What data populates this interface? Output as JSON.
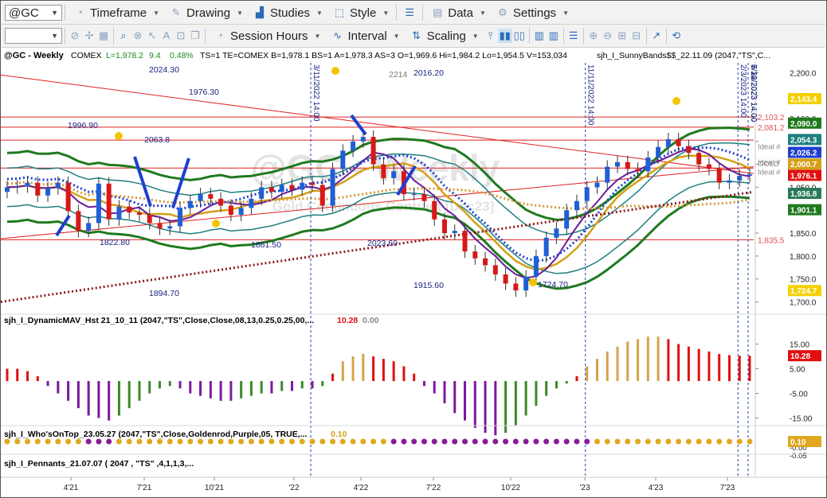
{
  "toolbar1": {
    "symbol_value": "@GC",
    "timeframe": "Timeframe",
    "drawing": "Drawing",
    "studies": "Studies",
    "style": "Style",
    "data": "Data",
    "settings": "Settings"
  },
  "toolbar2": {
    "session_hours": "Session Hours",
    "interval": "Interval",
    "scaling": "Scaling"
  },
  "chart_data": {
    "type": "candlestick",
    "header": {
      "symbol": "@GC - Weekly",
      "exchange": "COMEX",
      "last": "L=1,978.2",
      "change": "9.4",
      "pct": "0.48%",
      "rest": "TS=1  TE=COMEX  B=1,978.1  BS=1  A=1,978.3  AS=3  O=1,969.6  Hi=1,984.2  Lo=1,954.5  V=153,034",
      "study": "sjh_I_SunnyBands$$_22.11.09 (2047,\"TS\",C..."
    },
    "watermark": "@GC - Weekly",
    "watermark2": "Gold Continuous Contract [Dec23]",
    "x_ticks": [
      "4'21",
      "7'21",
      "10'21",
      "'22",
      "4'22",
      "7'22",
      "10'22",
      "'23",
      "4'23",
      "7'23"
    ],
    "y_ticks": [
      "2,200.0",
      "2,150.0",
      "2,100.0",
      "2,050.0",
      "2,000.0",
      "1,950.0",
      "1,900.0",
      "1,850.0",
      "1,800.0",
      "1,750.0",
      "1,700.0"
    ],
    "ylim": [
      1680,
      2225
    ],
    "close": [
      1950,
      1952,
      1960,
      1932,
      1948,
      1960,
      1898,
      1855,
      1872,
      1958,
      1880,
      1908,
      1895,
      1890,
      1872,
      1860,
      1865,
      1905,
      1920,
      1935,
      1925,
      1910,
      1890,
      1905,
      1925,
      1950,
      1940,
      1955,
      1945,
      1960,
      1955,
      1910,
      1990,
      2030,
      2050,
      2060,
      2000,
      1970,
      1985,
      1935,
      1935,
      1920,
      1880,
      1850,
      1855,
      1810,
      1795,
      1780,
      1760,
      1740,
      1725,
      1755,
      1800,
      1840,
      1860,
      1900,
      1920,
      1950,
      1960,
      1995,
      2005,
      1990,
      1985,
      2015,
      2038,
      2055,
      2040,
      2025,
      2000,
      1990,
      1960,
      1965,
      1975,
      1978
    ],
    "drawn_price_labels": [
      "2024.30",
      "1976.30",
      "1996.90",
      "2063.8",
      "2214",
      "2016.20",
      "1822.80",
      "1861.50",
      "2023.60",
      "1894.70",
      "1915.60",
      "1724.70"
    ],
    "drawn_date_labels": [
      "3/11/2022 14:00",
      "11/11/2022 14:00",
      "2/3/2023 14:00",
      "3/10/2023 14:00",
      "5/12/2023",
      "6/30/2023 14:00",
      "7/21/2023 14:00"
    ],
    "level_labels": [
      "2,103.2",
      "2,081.2",
      "1,835.5"
    ],
    "level_values": [
      2103.2,
      2081.2,
      1835.5
    ],
    "right_tags": [
      {
        "value": "2,143.4",
        "color": "#f5d000",
        "text_color": "#ffffff"
      },
      {
        "value": "2,090.0",
        "color": "#1f7a1f",
        "text_color": "#ffffff"
      },
      {
        "value": "2,054.3",
        "color": "#1f7f7f",
        "text_color": "#ffffff"
      },
      {
        "value": "2,026.2",
        "color": "#1f3fd0",
        "text_color": "#ffffff"
      },
      {
        "value": "2,000.7",
        "color": "#d4a017",
        "text_color": "#ffffff"
      },
      {
        "value": "1,976.1",
        "color": "#e01010",
        "text_color": "#ffffff"
      },
      {
        "value": "1,936.8",
        "color": "#2a7a5a",
        "text_color": "#ffffff"
      },
      {
        "value": "1,901.1",
        "color": "#1f7a1f",
        "text_color": "#ffffff"
      },
      {
        "value": "1,724.7",
        "color": "#f5d000",
        "text_color": "#ffffff"
      }
    ],
    "right_small": [
      "Ideal #",
      "Ideal #",
      "Ideal #"
    ],
    "ideal_values": [
      2040,
      2006,
      1985
    ],
    "gold_label": "GOLD",
    "panel2": {
      "label": "sjh_I_DynamicMAV_Hst 21_10_11 (2047,\"TS\",Close,Close,08,13,0.25,0.25,00,...",
      "v1": "10.28",
      "v2": "0.00",
      "y_ticks": [
        "15.00",
        "5.00",
        "-5.00",
        "-15.00"
      ],
      "tag": "10.28",
      "values": [
        5,
        5,
        4,
        2,
        -2,
        -5,
        -8,
        -11,
        -14,
        -15,
        -16,
        -14,
        -11,
        -8,
        -5,
        -3,
        -2,
        -3,
        -5,
        -6,
        -7,
        -8,
        -8,
        -7,
        -6,
        -5,
        -5,
        -4,
        -4,
        -3,
        -3,
        -2,
        3,
        8,
        10,
        11,
        10,
        9,
        8,
        6,
        3,
        -2,
        -5,
        -9,
        -13,
        -16,
        -19,
        -21,
        -22,
        -21,
        -18,
        -14,
        -10,
        -6,
        -3,
        -1,
        2,
        6,
        9,
        12,
        14,
        16,
        17,
        18,
        18,
        17,
        15,
        14,
        13,
        12,
        11,
        10.5,
        10.3,
        10.28
      ]
    },
    "panel3": {
      "label": "sjh_I_Who'sOnTop_23.05.27 (2047,\"TS\",Close,Goldenrod,Purple,05,  TRUE,...",
      "v1": "0.10",
      "y_ticks": [
        "0.05",
        "-0.00",
        "-0.05"
      ],
      "tag": "0.10",
      "colors": [
        "g",
        "g",
        "g",
        "g",
        "g",
        "g",
        "g",
        "g",
        "p",
        "p",
        "p",
        "g",
        "g",
        "g",
        "g",
        "g",
        "g",
        "g",
        "g",
        "g",
        "g",
        "g",
        "g",
        "g",
        "g",
        "g",
        "g",
        "g",
        "g",
        "g",
        "g",
        "g",
        "g",
        "g",
        "g",
        "g",
        "g",
        "g",
        "p",
        "p",
        "p",
        "p",
        "p",
        "p",
        "p",
        "p",
        "p",
        "p",
        "p",
        "p",
        "p",
        "p",
        "p",
        "p",
        "p",
        "p",
        "p",
        "p",
        "g",
        "g",
        "g",
        "g",
        "g",
        "g",
        "g",
        "g",
        "g",
        "g",
        "g",
        "g",
        "g",
        "g",
        "g",
        "g"
      ]
    },
    "panel4": {
      "label": "sjh_I_Pennants_21.07.07 ( 2047 , \"TS\" ,4,1,1,3,..."
    },
    "colors": {
      "up": "#1f5fd6",
      "down": "#d81818",
      "teal_band": "#1f7f7f",
      "green_band": "#1f7a1f",
      "purple": "#6a1b9a",
      "gold": "#d4a017",
      "blue_dots": "#1f3fd0",
      "maroon_dots": "#8b1a1a",
      "orange_dots": "#d49a3a",
      "hist_red": "#e01010",
      "hist_gold": "#d4a44a",
      "hist_purple": "#7a1aa0",
      "hist_green": "#3a8a2a"
    }
  }
}
